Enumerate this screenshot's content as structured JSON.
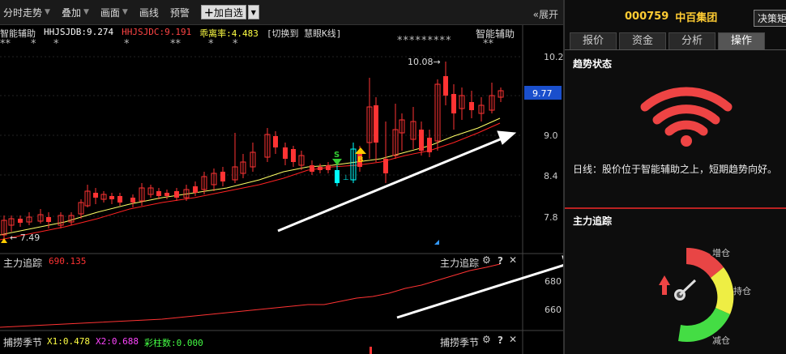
{
  "toolbar": {
    "intraday": "分时走势",
    "overlay": "叠加",
    "draw": "画面",
    "line_draw": "画线",
    "alert": "预警",
    "add_watch": "加自选",
    "expand": "展开"
  },
  "indicator_main": {
    "name": "智能辅助",
    "jdb": "HHJSJDB:9.274",
    "jdc": "HHJSJDC:9.191",
    "bias": "乖离率:4.483",
    "switch": "[切换到 慧眼K线]",
    "star_right": "*********",
    "name_right": "智能辅助"
  },
  "price_axis": {
    "ticks": [
      "10.2",
      "9.0",
      "8.4",
      "7.8"
    ],
    "current": "9.77",
    "high_label": "10.08",
    "low_label": "7.49"
  },
  "sub1": {
    "name": "主力追踪",
    "value": "690.135",
    "right_name": "主力追踪",
    "ticks": [
      "680",
      "660"
    ]
  },
  "sub2": {
    "name": "捕捞季节",
    "x1": "X1:0.478",
    "x2": "X2:0.688",
    "bar": "彩柱数:0.000",
    "right_name": "捕捞季节"
  },
  "signals": {
    "buy": "B",
    "sell": "S"
  },
  "right_panel": {
    "code": "000759",
    "name": "中百集团",
    "decision": "决策矩",
    "tabs": [
      "报价",
      "资金",
      "分析",
      "操作"
    ],
    "active_tab": 3,
    "trend_title": "趋势状态",
    "trend_text": "日线：股价位于智能辅助之上，短期趋势向好。",
    "main_title": "主力追踪",
    "gauge_labels": [
      "增仓",
      "持仓",
      "减仓"
    ]
  },
  "colors": {
    "up": "#ff3333",
    "down": "#00ffff",
    "ma_yellow": "#ffff66",
    "ma_red": "#ff2222",
    "accent_gold": "#ffcc33"
  }
}
